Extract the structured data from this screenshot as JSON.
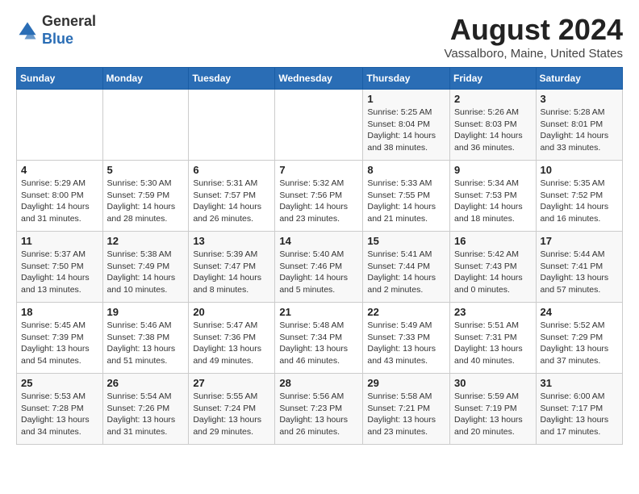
{
  "header": {
    "logo_line1": "General",
    "logo_line2": "Blue",
    "month_year": "August 2024",
    "location": "Vassalboro, Maine, United States"
  },
  "days_of_week": [
    "Sunday",
    "Monday",
    "Tuesday",
    "Wednesday",
    "Thursday",
    "Friday",
    "Saturday"
  ],
  "weeks": [
    [
      {
        "day": "",
        "info": ""
      },
      {
        "day": "",
        "info": ""
      },
      {
        "day": "",
        "info": ""
      },
      {
        "day": "",
        "info": ""
      },
      {
        "day": "1",
        "info": "Sunrise: 5:25 AM\nSunset: 8:04 PM\nDaylight: 14 hours\nand 38 minutes."
      },
      {
        "day": "2",
        "info": "Sunrise: 5:26 AM\nSunset: 8:03 PM\nDaylight: 14 hours\nand 36 minutes."
      },
      {
        "day": "3",
        "info": "Sunrise: 5:28 AM\nSunset: 8:01 PM\nDaylight: 14 hours\nand 33 minutes."
      }
    ],
    [
      {
        "day": "4",
        "info": "Sunrise: 5:29 AM\nSunset: 8:00 PM\nDaylight: 14 hours\nand 31 minutes."
      },
      {
        "day": "5",
        "info": "Sunrise: 5:30 AM\nSunset: 7:59 PM\nDaylight: 14 hours\nand 28 minutes."
      },
      {
        "day": "6",
        "info": "Sunrise: 5:31 AM\nSunset: 7:57 PM\nDaylight: 14 hours\nand 26 minutes."
      },
      {
        "day": "7",
        "info": "Sunrise: 5:32 AM\nSunset: 7:56 PM\nDaylight: 14 hours\nand 23 minutes."
      },
      {
        "day": "8",
        "info": "Sunrise: 5:33 AM\nSunset: 7:55 PM\nDaylight: 14 hours\nand 21 minutes."
      },
      {
        "day": "9",
        "info": "Sunrise: 5:34 AM\nSunset: 7:53 PM\nDaylight: 14 hours\nand 18 minutes."
      },
      {
        "day": "10",
        "info": "Sunrise: 5:35 AM\nSunset: 7:52 PM\nDaylight: 14 hours\nand 16 minutes."
      }
    ],
    [
      {
        "day": "11",
        "info": "Sunrise: 5:37 AM\nSunset: 7:50 PM\nDaylight: 14 hours\nand 13 minutes."
      },
      {
        "day": "12",
        "info": "Sunrise: 5:38 AM\nSunset: 7:49 PM\nDaylight: 14 hours\nand 10 minutes."
      },
      {
        "day": "13",
        "info": "Sunrise: 5:39 AM\nSunset: 7:47 PM\nDaylight: 14 hours\nand 8 minutes."
      },
      {
        "day": "14",
        "info": "Sunrise: 5:40 AM\nSunset: 7:46 PM\nDaylight: 14 hours\nand 5 minutes."
      },
      {
        "day": "15",
        "info": "Sunrise: 5:41 AM\nSunset: 7:44 PM\nDaylight: 14 hours\nand 2 minutes."
      },
      {
        "day": "16",
        "info": "Sunrise: 5:42 AM\nSunset: 7:43 PM\nDaylight: 14 hours\nand 0 minutes."
      },
      {
        "day": "17",
        "info": "Sunrise: 5:44 AM\nSunset: 7:41 PM\nDaylight: 13 hours\nand 57 minutes."
      }
    ],
    [
      {
        "day": "18",
        "info": "Sunrise: 5:45 AM\nSunset: 7:39 PM\nDaylight: 13 hours\nand 54 minutes."
      },
      {
        "day": "19",
        "info": "Sunrise: 5:46 AM\nSunset: 7:38 PM\nDaylight: 13 hours\nand 51 minutes."
      },
      {
        "day": "20",
        "info": "Sunrise: 5:47 AM\nSunset: 7:36 PM\nDaylight: 13 hours\nand 49 minutes."
      },
      {
        "day": "21",
        "info": "Sunrise: 5:48 AM\nSunset: 7:34 PM\nDaylight: 13 hours\nand 46 minutes."
      },
      {
        "day": "22",
        "info": "Sunrise: 5:49 AM\nSunset: 7:33 PM\nDaylight: 13 hours\nand 43 minutes."
      },
      {
        "day": "23",
        "info": "Sunrise: 5:51 AM\nSunset: 7:31 PM\nDaylight: 13 hours\nand 40 minutes."
      },
      {
        "day": "24",
        "info": "Sunrise: 5:52 AM\nSunset: 7:29 PM\nDaylight: 13 hours\nand 37 minutes."
      }
    ],
    [
      {
        "day": "25",
        "info": "Sunrise: 5:53 AM\nSunset: 7:28 PM\nDaylight: 13 hours\nand 34 minutes."
      },
      {
        "day": "26",
        "info": "Sunrise: 5:54 AM\nSunset: 7:26 PM\nDaylight: 13 hours\nand 31 minutes."
      },
      {
        "day": "27",
        "info": "Sunrise: 5:55 AM\nSunset: 7:24 PM\nDaylight: 13 hours\nand 29 minutes."
      },
      {
        "day": "28",
        "info": "Sunrise: 5:56 AM\nSunset: 7:23 PM\nDaylight: 13 hours\nand 26 minutes."
      },
      {
        "day": "29",
        "info": "Sunrise: 5:58 AM\nSunset: 7:21 PM\nDaylight: 13 hours\nand 23 minutes."
      },
      {
        "day": "30",
        "info": "Sunrise: 5:59 AM\nSunset: 7:19 PM\nDaylight: 13 hours\nand 20 minutes."
      },
      {
        "day": "31",
        "info": "Sunrise: 6:00 AM\nSunset: 7:17 PM\nDaylight: 13 hours\nand 17 minutes."
      }
    ]
  ]
}
